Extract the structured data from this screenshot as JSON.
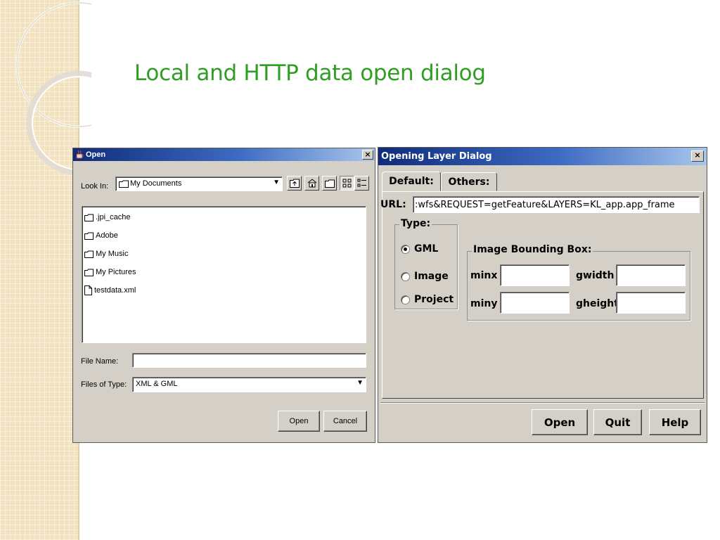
{
  "slide": {
    "title": "Local and HTTP data open dialog"
  },
  "open_dialog": {
    "title": "Open",
    "look_in_label": "Look In:",
    "look_in_value": "My Documents",
    "files": [
      {
        "name": ".jpi_cache",
        "type": "folder"
      },
      {
        "name": "Adobe",
        "type": "folder"
      },
      {
        "name": "My Music",
        "type": "folder"
      },
      {
        "name": "My Pictures",
        "type": "folder"
      },
      {
        "name": "testdata.xml",
        "type": "file"
      }
    ],
    "file_name_label": "File Name:",
    "file_name_value": "",
    "files_of_type_label": "Files of Type:",
    "files_of_type_value": "XML & GML",
    "open_label": "Open",
    "cancel_label": "Cancel"
  },
  "layer_dialog": {
    "title": "Opening Layer Dialog",
    "tabs": [
      {
        "label": "Default:",
        "active": true
      },
      {
        "label": "Others:",
        "active": false
      }
    ],
    "url_label": "URL:",
    "url_value": ":wfs&REQUEST=getFeature&LAYERS=KL_app.app_frame",
    "type_group_title": "Type:",
    "type_options": [
      {
        "label": "GML",
        "selected": true
      },
      {
        "label": "Image",
        "selected": false
      },
      {
        "label": "Project",
        "selected": false
      }
    ],
    "bbox_group_title": "Image Bounding Box:",
    "bbox_fields": {
      "minx_label": "minx",
      "minx_value": "",
      "gwidth_label": "gwidth",
      "gwidth_value": "",
      "miny_label": "miny",
      "miny_value": "",
      "gheight_label": "gheight",
      "gheight_value": ""
    },
    "open_label": "Open",
    "quit_label": "Quit",
    "help_label": "Help"
  },
  "colors": {
    "title_green": "#2f9e23",
    "window_face": "#d4d0c8",
    "titlebar_start": "#102c7a",
    "titlebar_end": "#a9c6ec"
  }
}
